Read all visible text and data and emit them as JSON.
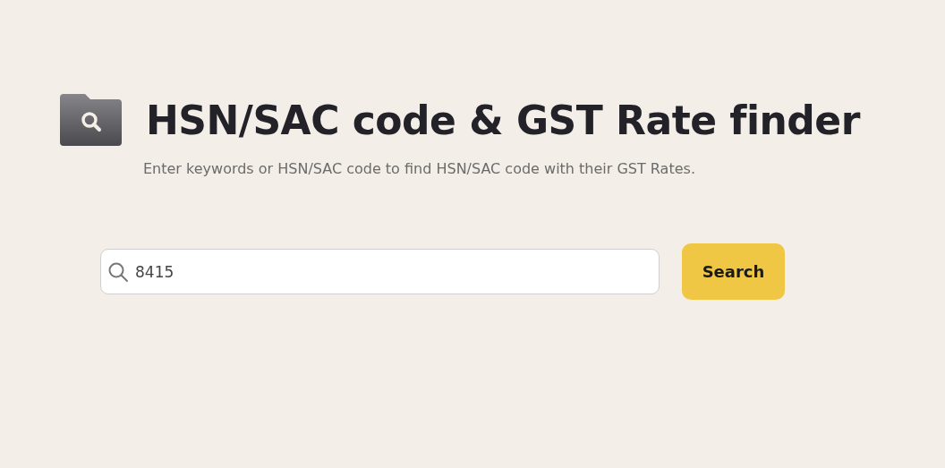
{
  "header": {
    "title": "HSN/SAC code & GST Rate finder",
    "subtitle": "Enter keywords or HSN/SAC code to find HSN/SAC code with their GST Rates."
  },
  "search": {
    "value": "8415",
    "button": "Search"
  }
}
